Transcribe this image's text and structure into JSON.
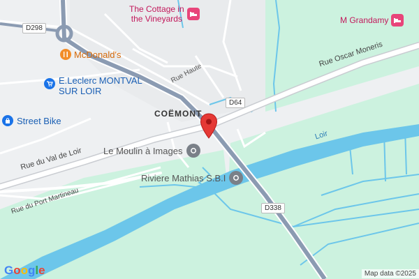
{
  "map": {
    "attribution": "Map data ©2025",
    "logo": "Google",
    "colors": {
      "land": "#eef0f2",
      "park": "#ccf2df",
      "water": "#6cc6ea",
      "highway": "#8b9bb2",
      "road": "#ffffff",
      "poi_orange": "#f28d29",
      "poi_blue": "#1a73e8",
      "poi_pink": "#e8457a",
      "poi_gray": "#7a8088",
      "marker": "#e53935"
    },
    "places": {
      "town": "COËMONT",
      "river": "Loir"
    },
    "roads": {
      "d298": "D298",
      "d64": "D64",
      "d338": "D338",
      "rue_haute": "Rue Haute",
      "rue_oscar": "Rue Oscar Moneris",
      "rue_val": "Rue du Val de Loir",
      "rue_port": "Rue du Port Martineau"
    },
    "pois": {
      "cottage_line1": "The Cottage in",
      "cottage_line2": "the Vineyards",
      "grandamy": "M Grandamy",
      "mcdonalds": "McDonald's",
      "leclerc_line1": "E.Leclerc MONTVAL",
      "leclerc_line2": "SUR LOIR",
      "street_bike": "Street Bike",
      "moulin": "Le Moulin à Images",
      "riviere": "Riviere Mathias S.B.I"
    },
    "icons": {
      "hotel": "bed-icon",
      "food": "fork-knife-icon",
      "shopping": "shopping-cart-icon",
      "store": "shopping-bag-icon",
      "place": "pin-icon"
    }
  }
}
